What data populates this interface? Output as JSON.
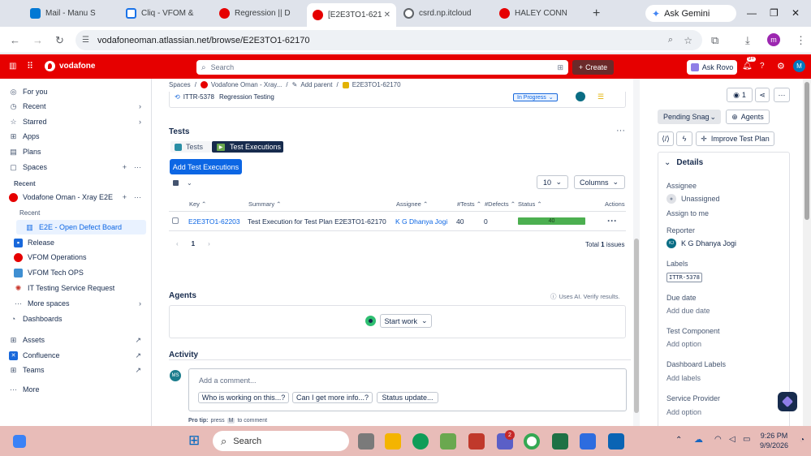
{
  "browser": {
    "tabs": [
      {
        "title": "Mail - Manu S",
        "color": "#0078d4"
      },
      {
        "title": "Cliq - VFOM &",
        "color": "#1a73e8"
      },
      {
        "title": "Regression || D",
        "color": "#e60000"
      },
      {
        "title": "[E2E3TO1-621",
        "color": "#e60000"
      },
      {
        "title": "csrd.np.itcloud",
        "color": "#5f6368"
      },
      {
        "title": "HALEY CONN",
        "color": "#e60000"
      }
    ],
    "gemini_label": "Ask Gemini",
    "url": "vodafoneoman.atlassian.net/browse/E2E3TO1-62170",
    "profile_initial": "m"
  },
  "topbar": {
    "brand": "vodafone",
    "search_placeholder": "Search",
    "create_label": "Create",
    "rovo_label": "Ask Rovo",
    "notif_badge": "9+",
    "avatar": "M"
  },
  "sidebar": {
    "for_you": "For you",
    "recent": "Recent",
    "starred": "Starred",
    "apps": "Apps",
    "plans": "Plans",
    "spaces": "Spaces",
    "recent_header": "Recent",
    "space_name": "Vodafone Oman - Xray E2E",
    "sub_recent": "Recent",
    "board": "E2E - Open Defect Board",
    "release": "Release",
    "vfom_ops": "VFOM Operations",
    "vfom_tech": "VFOM Tech OPS",
    "it_testing": "IT Testing Service Request",
    "more_spaces": "More spaces",
    "dashboards": "Dashboards",
    "assets": "Assets",
    "confluence": "Confluence",
    "teams": "Teams",
    "more": "More"
  },
  "breadcrumb": {
    "spaces": "Spaces",
    "project": "Vodafone Oman - Xray...",
    "add_parent": "Add parent",
    "issue_key": "E2E3TO1-62170"
  },
  "linked": {
    "key": "ITTR-5378",
    "summary": "Regression Testing",
    "status": "In Progress"
  },
  "tests": {
    "heading": "Tests",
    "tab_tests": "Tests",
    "tab_execs": "Test Executions",
    "add_button": "Add Test Executions",
    "page_size": "10",
    "columns_label": "Columns",
    "headers": {
      "key": "Key",
      "summary": "Summary",
      "assignee": "Assignee",
      "tests": "#Tests",
      "defects": "#Defects",
      "status": "Status",
      "actions": "Actions"
    },
    "rows": [
      {
        "key": "E2E3TO1-62203",
        "summary": "Execution for Test Plan E2E3TO1-62170",
        "summary_prefix": "Test",
        "assignee": "K G Dhanya Jogi",
        "tests": "40",
        "defects": "0",
        "status_count": "40",
        "status_fraction": 1.0
      }
    ],
    "page": "1",
    "total_prefix": "Total",
    "total_count": "1",
    "total_suffix": "issues"
  },
  "agents": {
    "heading": "Agents",
    "ai_note": "Uses AI. Verify results.",
    "start_work": "Start work"
  },
  "activity": {
    "heading": "Activity",
    "avatar": "MS",
    "comment_placeholder": "Add a comment...",
    "chips": [
      "Who is working on this...?",
      "Can I get more info...?",
      "Status update..."
    ],
    "protip_label": "Pro tip:",
    "protip_text1": "press",
    "protip_key": "M",
    "protip_text2": "to comment"
  },
  "right_panel": {
    "watch_count": "1",
    "status": "Pending Snag",
    "agents_label": "Agents",
    "improve_label": "Improve Test Plan",
    "details_heading": "Details",
    "assignee_label": "Assignee",
    "assignee_value": "Unassigned",
    "assign_to_me": "Assign to me",
    "reporter_label": "Reporter",
    "reporter_initials": "KJ",
    "reporter_value": "K G Dhanya Jogi",
    "labels_label": "Labels",
    "labels_value": "ITTR-5378",
    "due_label": "Due date",
    "due_value": "Add due date",
    "test_comp_label": "Test Component",
    "test_comp_value": "Add option",
    "dash_labels_label": "Dashboard Labels",
    "dash_labels_value": "Add labels",
    "service_label": "Service Provider",
    "service_value": "Add option"
  },
  "taskbar": {
    "search_label": "Search",
    "teams_badge": "2",
    "time": "9:26 PM",
    "date": "9/9/2026"
  },
  "colors": {
    "brand_red": "#e60000",
    "link_blue": "#0c66e4",
    "progress_green": "#4caf50",
    "primary_button": "#0c66e4",
    "dark_tab": "#172b4d"
  }
}
